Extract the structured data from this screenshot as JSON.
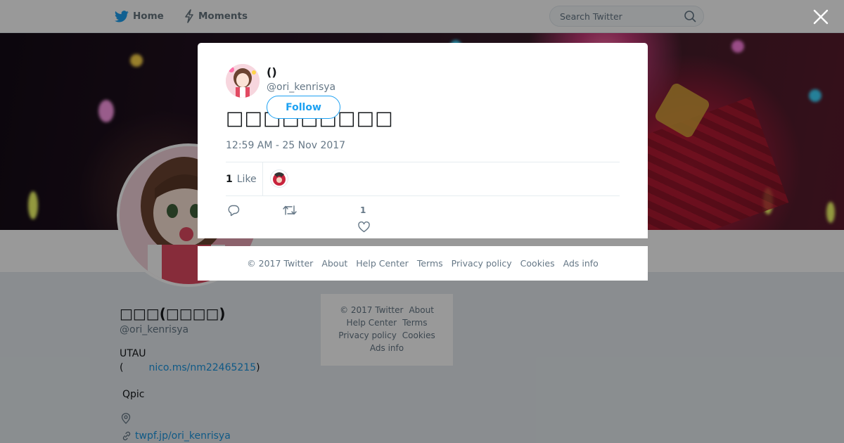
{
  "nav": {
    "home": "Home",
    "moments": "Moments"
  },
  "search": {
    "placeholder": "Search Twitter"
  },
  "profile": {
    "name": "□□□(□□□□)",
    "handle": "@ori_kenrisya",
    "bio_line1": "UTAU",
    "bio_line2_prefix": "(",
    "bio_link": "nico.ms/nm22465215",
    "bio_line2_suffix": ")",
    "qpic": "Qpic",
    "website": "twpf.jp/ori_kenrisya"
  },
  "side_footer": [
    "© 2017 Twitter",
    "About",
    "Help Center",
    "Terms",
    "Privacy policy",
    "Cookies",
    "Ads info"
  ],
  "tweet": {
    "author_name": "()",
    "author_handle": "@ori_kenrisya",
    "follow_label": "Follow",
    "text": "□□□□□□□□□",
    "timestamp": "12:59 AM - 25 Nov 2017",
    "likes_count": "1",
    "likes_label": "Like",
    "like_action_count": "1"
  },
  "modal_footer": [
    "© 2017 Twitter",
    "About",
    "Help Center",
    "Terms",
    "Privacy policy",
    "Cookies",
    "Ads info"
  ],
  "colors": {
    "accent": "#1da1f2",
    "link": "#1b95e0",
    "muted": "#657786",
    "overlay": "rgba(0,0,0,0.40)"
  },
  "icons": [
    "twitter-bird-icon",
    "lightning-icon",
    "search-icon",
    "close-icon",
    "reply-icon",
    "retweet-icon",
    "heart-icon",
    "location-icon",
    "link-icon"
  ]
}
